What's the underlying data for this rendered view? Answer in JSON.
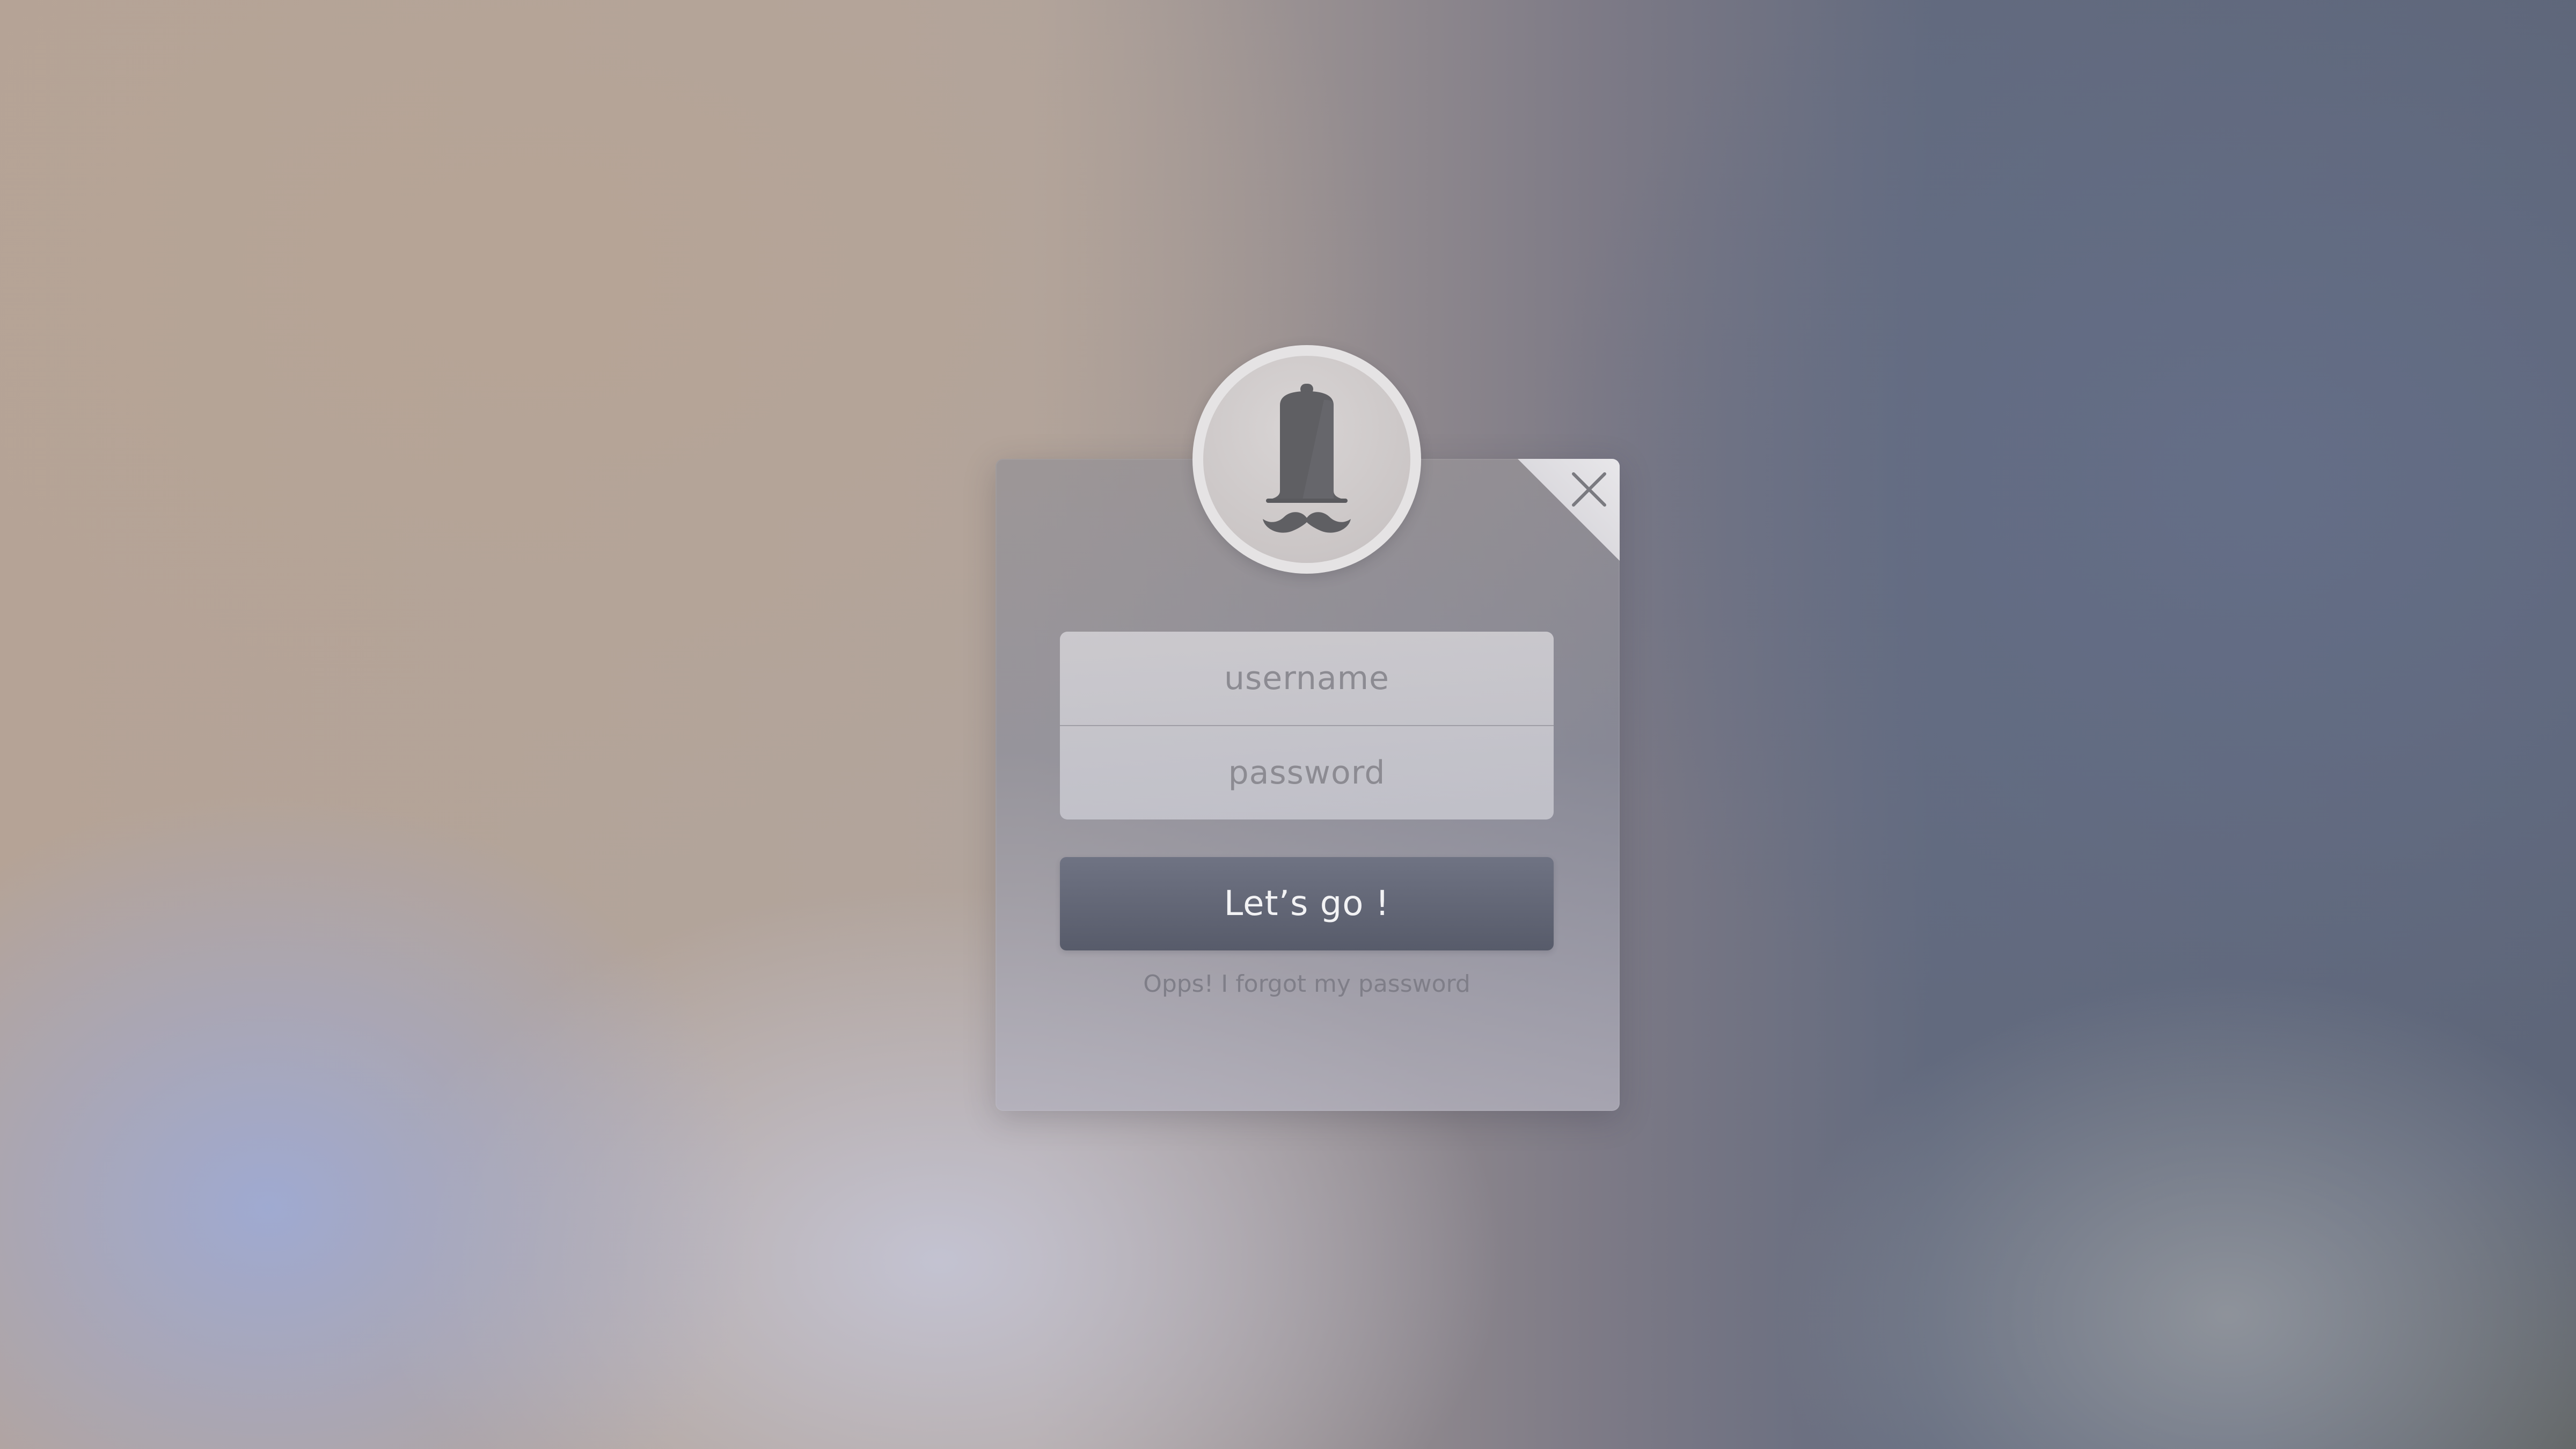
{
  "login": {
    "username_placeholder": "username",
    "password_placeholder": "password",
    "submit_label": "Let’s go !",
    "forgot_password_label": "Opps! I forgot my password"
  },
  "icons": {
    "avatar": "bell-with-mustache-icon",
    "close": "close-icon"
  },
  "colors": {
    "button": "#5f6373",
    "button_text": "#f2f2f4",
    "placeholder": "#8c8b92",
    "link": "#7f7e88",
    "avatar_ring": "#e5e3e4",
    "avatar_glyph": "#5f5f63"
  }
}
